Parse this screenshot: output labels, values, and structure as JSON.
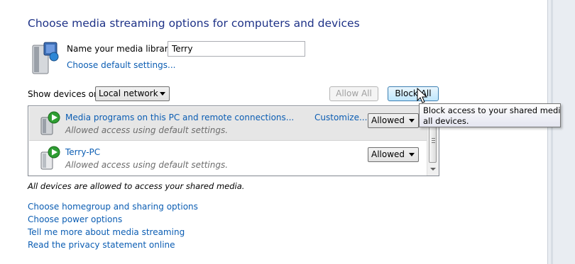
{
  "title": "Choose media streaming options for computers and devices",
  "library": {
    "label": "Name your media library:",
    "value": "Terry",
    "default_settings_link": "Choose default settings..."
  },
  "show_devices": {
    "label": "Show devices on:",
    "selected": "Local network"
  },
  "buttons": {
    "allow_all": "Allow All",
    "block_all": "Block All"
  },
  "devices": [
    {
      "name": "Media programs on this PC and remote connections...",
      "subtitle": "Allowed access using default settings.",
      "customize": "Customize...",
      "status": "Allowed"
    },
    {
      "name": "Terry-PC",
      "subtitle": "Allowed access using default settings.",
      "status": "Allowed"
    }
  ],
  "status_text": "All devices are allowed to access your shared media.",
  "links": [
    "Choose homegroup and sharing options",
    "Choose power options",
    "Tell me more about media streaming",
    "Read the privacy statement online"
  ],
  "tooltip": {
    "line1": "Block access to your shared media",
    "line2": "all devices."
  },
  "colors": {
    "title": "#1e3287",
    "link": "#0b5db3",
    "selected_row": "#e6e6e6"
  }
}
